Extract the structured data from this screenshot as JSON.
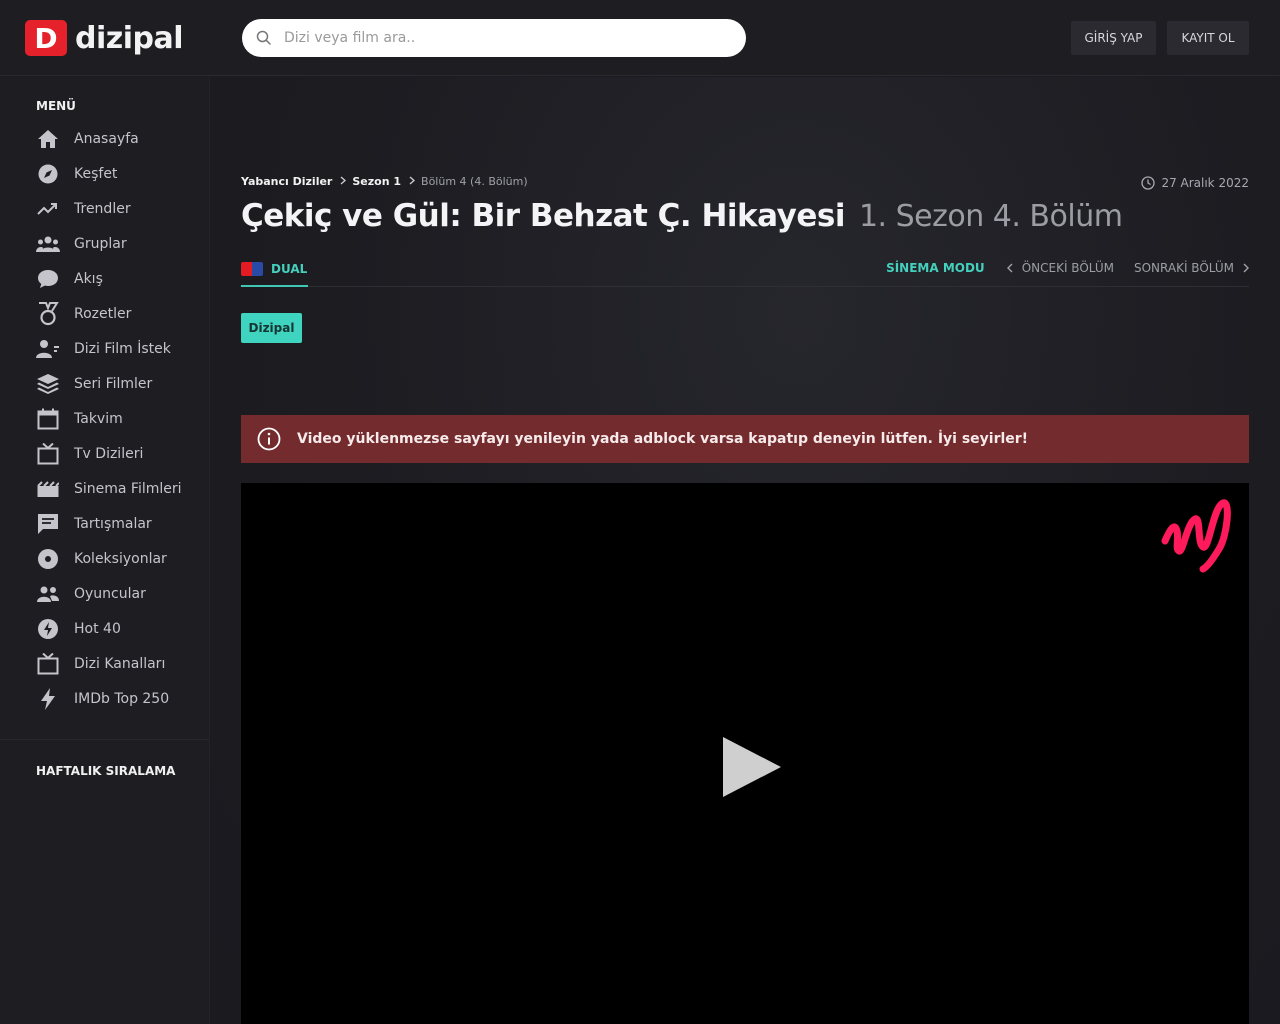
{
  "header": {
    "logo_badge": "D",
    "logo_text": "dizipal",
    "search_placeholder": "Dizi veya film ara..",
    "login_label": "GİRİŞ YAP",
    "register_label": "KAYIT OL"
  },
  "sidebar": {
    "menu_title": "MENÜ",
    "items": [
      {
        "label": "Anasayfa",
        "icon": "home-icon"
      },
      {
        "label": "Keşfet",
        "icon": "compass-icon"
      },
      {
        "label": "Trendler",
        "icon": "trending-icon"
      },
      {
        "label": "Gruplar",
        "icon": "groups-icon"
      },
      {
        "label": "Akış",
        "icon": "chat-bubble-icon"
      },
      {
        "label": "Rozetler",
        "icon": "medal-icon"
      },
      {
        "label": "Dizi Film İstek",
        "icon": "user-request-icon"
      },
      {
        "label": "Seri Filmler",
        "icon": "layers-icon"
      },
      {
        "label": "Takvim",
        "icon": "calendar-icon"
      },
      {
        "label": "Tv Dizileri",
        "icon": "tv-icon"
      },
      {
        "label": "Sinema Filmleri",
        "icon": "film-icon"
      },
      {
        "label": "Tartışmalar",
        "icon": "forum-icon"
      },
      {
        "label": "Koleksiyonlar",
        "icon": "disc-icon"
      },
      {
        "label": "Oyuncular",
        "icon": "people-icon"
      },
      {
        "label": "Hot 40",
        "icon": "hot-icon"
      },
      {
        "label": "Dizi Kanalları",
        "icon": "tv-channel-icon"
      },
      {
        "label": "IMDb Top 250",
        "icon": "lightning-icon"
      }
    ],
    "weekly_title": "HAFTALIK SIRALAMA"
  },
  "main": {
    "breadcrumb": {
      "category": "Yabancı Diziler",
      "season": "Sezon 1",
      "current": "Bölüm 4 (4. Bölüm)"
    },
    "date": "27 Aralık 2022",
    "title": "Çekiç ve Gül: Bir Behzat Ç. Hikayesi",
    "subtitle": "1. Sezon 4. Bölüm",
    "tab_dual": "DUAL",
    "cinema_mode": "SİNEMA MODU",
    "prev_episode": "ÖNCEKİ BÖLÜM",
    "next_episode": "SONRAKİ BÖLÜM",
    "source_label": "Dizipal",
    "alert_text": "Video yüklenmezse sayfayı yenileyin yada adblock varsa kapatıp deneyin lütfen. İyi seyirler!"
  },
  "colors": {
    "accent": "#45d0bd",
    "brand": "#e5212b",
    "alert_bg": "#732b2e",
    "player_logo": "#ff1a5b"
  }
}
